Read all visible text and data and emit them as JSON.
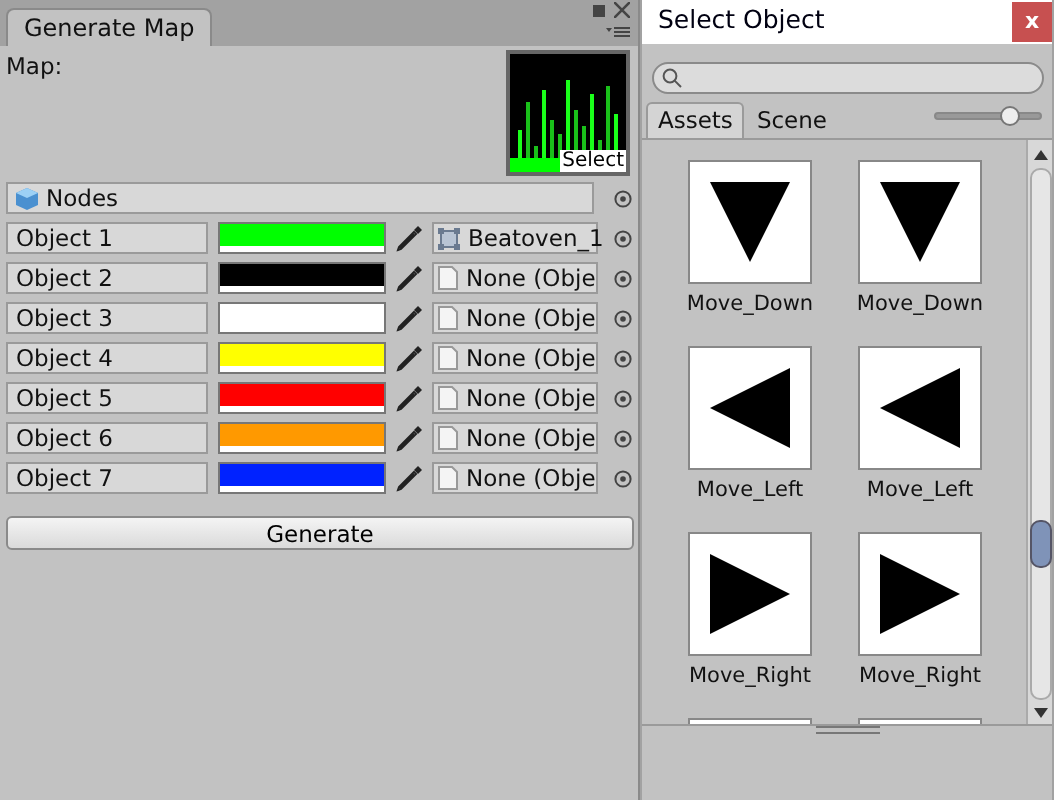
{
  "generate_map": {
    "tab": {
      "label": "Generate Map"
    },
    "map": {
      "label": "Map:",
      "select": "Select"
    },
    "nodes": {
      "value": "Nodes"
    },
    "objects": [
      {
        "label": "Object 1",
        "color": "#00ff00",
        "kind": "sprite",
        "value": "Beatoven_1"
      },
      {
        "label": "Object 2",
        "color": "#000000",
        "kind": "none",
        "value": "None (Obje"
      },
      {
        "label": "Object 3",
        "color": "#ffffff",
        "kind": "none",
        "value": "None (Obje"
      },
      {
        "label": "Object 4",
        "color": "#ffff00",
        "kind": "none",
        "value": "None (Obje"
      },
      {
        "label": "Object 5",
        "color": "#ff0000",
        "kind": "none",
        "value": "None (Obje"
      },
      {
        "label": "Object 6",
        "color": "#ff9900",
        "kind": "none",
        "value": "None (Obje"
      },
      {
        "label": "Object 7",
        "color": "#0022ff",
        "kind": "none",
        "value": "None (Obje"
      }
    ],
    "button": "Generate"
  },
  "select_object": {
    "title": "Select Object",
    "close": "x",
    "tabs": [
      {
        "label": "Assets",
        "selected": true
      },
      {
        "label": "Scene",
        "selected": false
      }
    ],
    "zoom": {
      "level": 0.7
    },
    "items": [
      {
        "label": "Move_Down",
        "kind": "down"
      },
      {
        "label": "Move_Down",
        "kind": "down"
      },
      {
        "label": "Move_Left",
        "kind": "left"
      },
      {
        "label": "Move_Left",
        "kind": "left"
      },
      {
        "label": "Move_Right",
        "kind": "right"
      },
      {
        "label": "Move_Right",
        "kind": "right"
      },
      {
        "kind": "blank"
      },
      {
        "kind": "blank"
      }
    ]
  }
}
